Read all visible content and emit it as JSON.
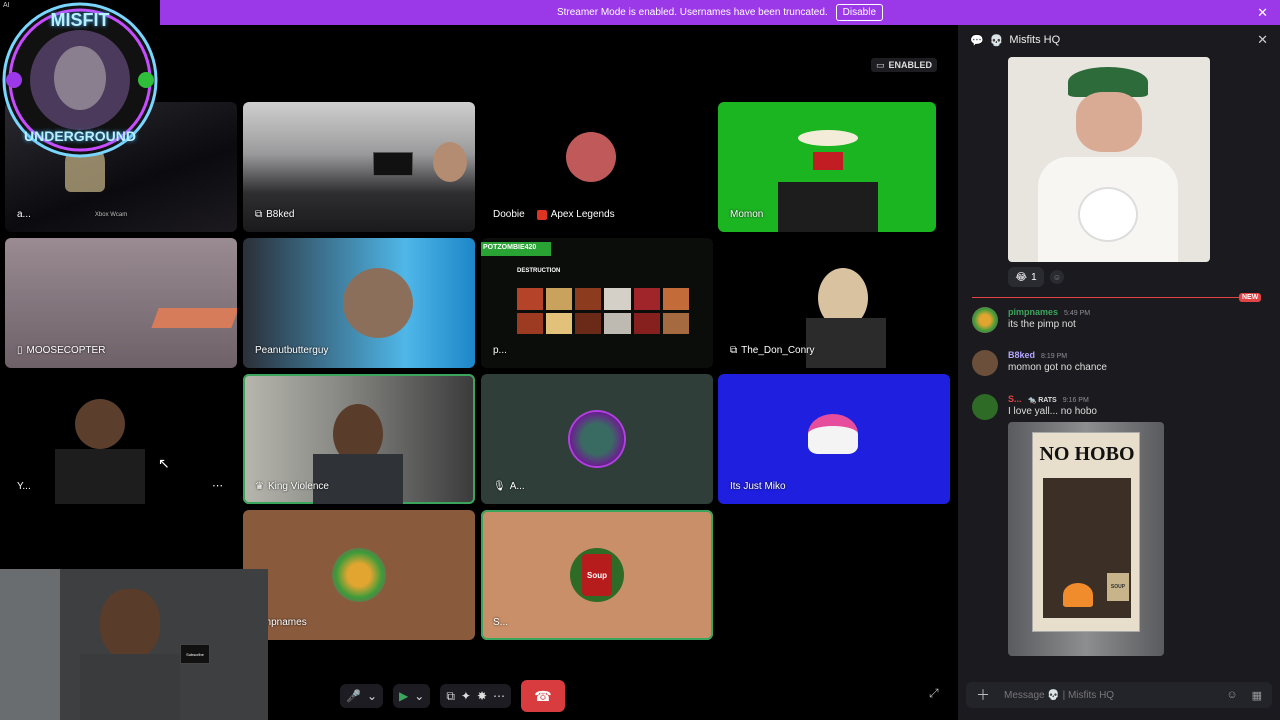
{
  "banner": {
    "text": "Streamer Mode is enabled. Usernames have been truncated.",
    "disable_label": "Disable",
    "bg": "#9b38e8"
  },
  "logo": {
    "line1": "MISFIT",
    "line2": "UNDERGROUND",
    "badge": "AI"
  },
  "enabled_pill": "ENABLED",
  "tiles": [
    {
      "name": "a...",
      "label_extra": "Xbox Wcam"
    },
    {
      "name": "B8ked"
    },
    {
      "name": "Doobie",
      "activity": "Apex Legends"
    },
    {
      "name": "Momon"
    },
    {
      "name": "MOOSECOPTER"
    },
    {
      "name": "Peanutbutterguy"
    },
    {
      "name": "p...",
      "stream_title": "POTZOMBIE420",
      "stream_sub": "DESTRUCTION"
    },
    {
      "name": "The_Don_Conry"
    },
    {
      "name": "Y..."
    },
    {
      "name": "King Violence"
    },
    {
      "name": "A..."
    },
    {
      "name": "Its Just Miko"
    },
    {
      "name": "pimpnames"
    },
    {
      "name": "S...",
      "avatar_text": "Soup"
    }
  ],
  "chat": {
    "channel": "Misfits HQ",
    "reaction_count": "1",
    "new_label": "NEW",
    "messages": [
      {
        "user": "pimpnames",
        "time": "5:49 PM",
        "text": "its the pimp not",
        "color": "#3ba55c"
      },
      {
        "user": "B8ked",
        "time": "8:19 PM",
        "text": "momon got no chance",
        "color": "#b6a5ff"
      },
      {
        "user": "S...",
        "tag": "RATS",
        "time": "9:16 PM",
        "text": "I love yall... no hobo",
        "color": "#e04444"
      }
    ],
    "poster": {
      "headline": "NO HOBO",
      "can_label": "SOUP"
    },
    "composer_placeholder": "Message 💀 | Misfits HQ"
  },
  "cam_sign": "Subscribe"
}
